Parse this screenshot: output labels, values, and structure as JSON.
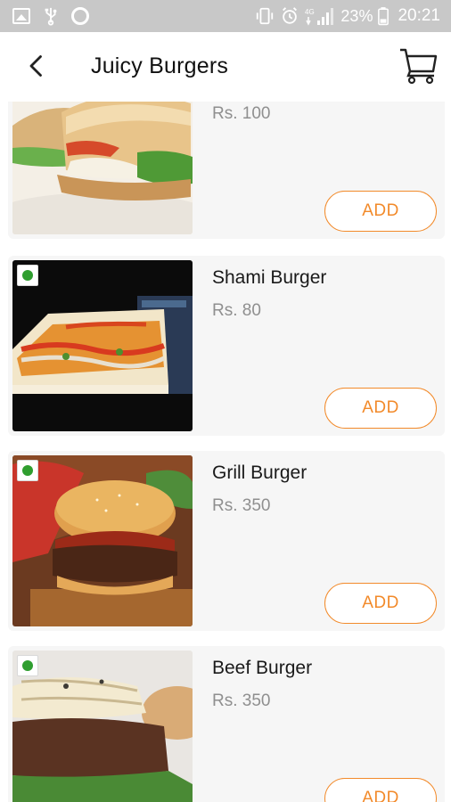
{
  "status_bar": {
    "battery_percent": "23%",
    "time": "20:21"
  },
  "header": {
    "title": "Juicy Burgers"
  },
  "icons": {
    "back": "arrow-left-icon",
    "cart": "shopping-cart-icon",
    "veg": "veg-indicator-icon"
  },
  "colors": {
    "accent": "#f28a2a",
    "veg_green": "#2f9e2f",
    "card_bg": "#f6f6f6"
  },
  "items": [
    {
      "name": "",
      "price": "Rs. 100",
      "add_label": "ADD",
      "veg": false
    },
    {
      "name": "Shami Burger",
      "price": "Rs. 80",
      "add_label": "ADD",
      "veg": true
    },
    {
      "name": "Grill Burger",
      "price": "Rs. 350",
      "add_label": "ADD",
      "veg": true
    },
    {
      "name": "Beef Burger",
      "price": "Rs. 350",
      "add_label": "ADD",
      "veg": true
    }
  ]
}
